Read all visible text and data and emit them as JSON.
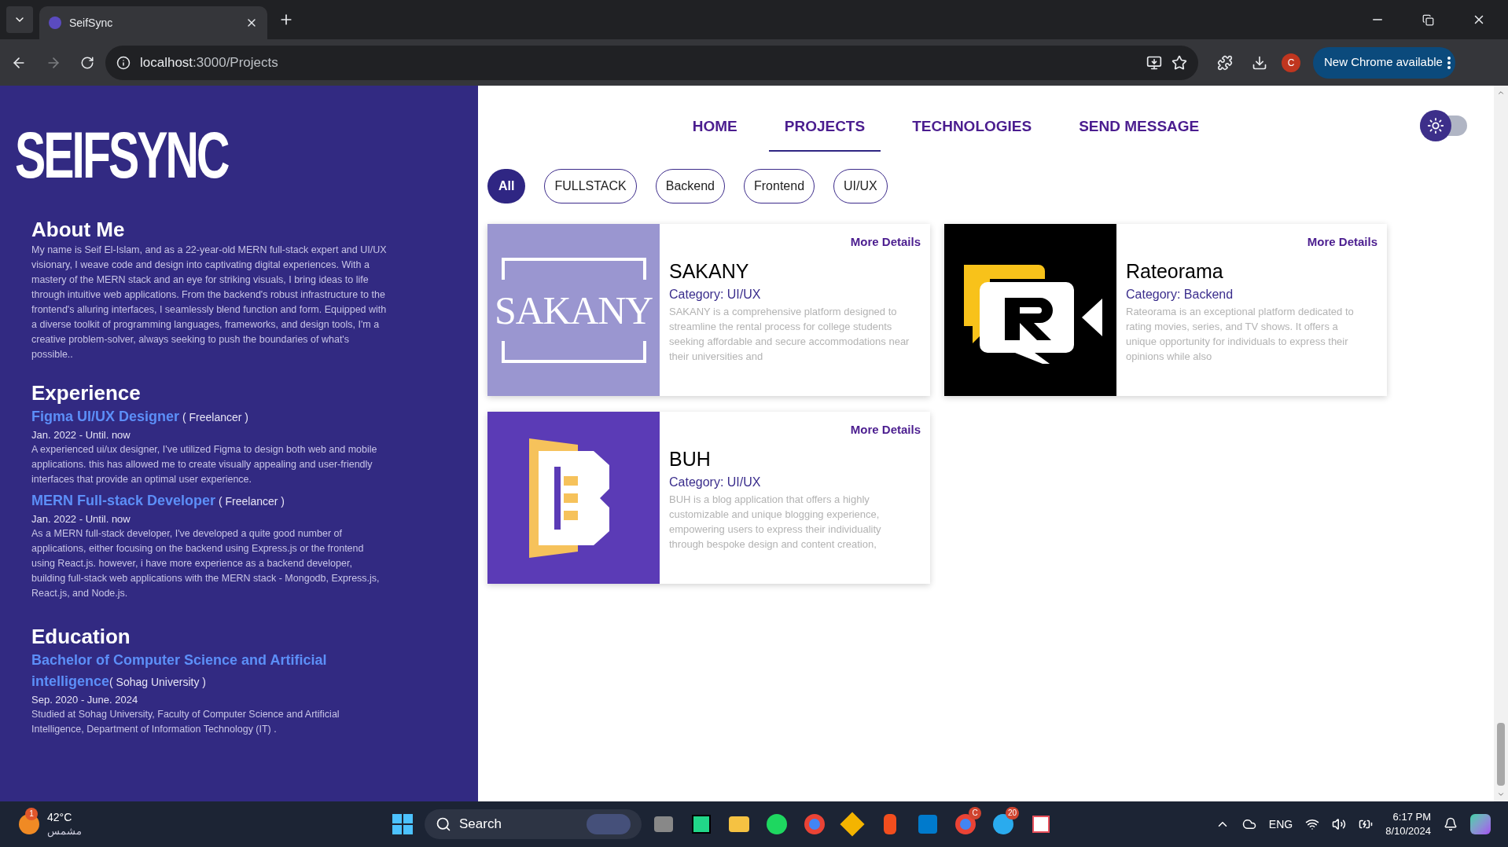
{
  "browser": {
    "tab_title": "SeifSync",
    "url_host": "localhost",
    "url_path": ":3000/Projects",
    "profile": "C",
    "update_button": "New Chrome available"
  },
  "sidebar": {
    "logo": "SEIFSYNC",
    "about": {
      "heading": "About Me",
      "text": "My name is Seif El-Islam, and as a 22-year-old MERN full-stack expert and UI/UX visionary, I weave code and design into captivating digital experiences. With a mastery of the MERN stack and an eye for striking visuals, I bring ideas to life through intuitive web applications. From the backend's robust infrastructure to the frontend's alluring interfaces, I seamlessly blend function and form. Equipped with a diverse toolkit of programming languages, frameworks, and design tools, I'm a creative problem-solver, always seeking to push the boundaries of what's possible.."
    },
    "experience": {
      "heading": "Experience",
      "items": [
        {
          "title": "Figma UI/UX Designer",
          "org": " ( Freelancer )",
          "dates": "Jan. 2022 - Until. now",
          "text": "A experienced ui/ux designer, I've utilized Figma to design both web and mobile applications. this has allowed me to create visually appealing and user-friendly interfaces that provide an optimal user experience."
        },
        {
          "title": "MERN Full-stack Developer",
          "org": " ( Freelancer )",
          "dates": "Jan. 2022 - Until. now",
          "text": "As a MERN full-stack developer, I've developed a quite good number of applications, either focusing on the backend using Express.js or the frontend using React.js. however, i have more experience as a backend developer, building full-stack web applications with the MERN stack - Mongodb, Express.js, React.js, and Node.js."
        }
      ]
    },
    "education": {
      "heading": "Education",
      "items": [
        {
          "title": "Bachelor of Computer Science and Artificial intelligence",
          "org": "( Sohag University )",
          "dates": "Sep. 2020 - June. 2024",
          "text": "Studied at Sohag University, Faculty of Computer Science and Artificial Intelligence, Department of Information Technology (IT) ."
        }
      ]
    }
  },
  "nav": {
    "items": [
      {
        "label": "HOME",
        "selected": false
      },
      {
        "label": "PROJECTS",
        "selected": true
      },
      {
        "label": "TECHNOLOGIES",
        "selected": false
      },
      {
        "label": "SEND MESSAGE",
        "selected": false
      }
    ],
    "theme_toggle": {
      "on": false
    }
  },
  "filters": [
    {
      "label": "All",
      "selected": true
    },
    {
      "label": "FULLSTACK",
      "selected": false
    },
    {
      "label": "Backend",
      "selected": false
    },
    {
      "label": "Frontend",
      "selected": false
    },
    {
      "label": "UI/UX",
      "selected": false
    }
  ],
  "projects": [
    {
      "kind": "sakany",
      "logo_text": "SAKANY",
      "title": "SAKANY",
      "category": "Category: UI/UX",
      "description": "SAKANY is a comprehensive platform designed to streamline the rental process for college students seeking affordable and secure accommodations near their universities and",
      "link": "More Details"
    },
    {
      "kind": "rateorama",
      "title": "Rateorama",
      "category": "Category: Backend",
      "description": "Rateorama is an exceptional platform dedicated to rating movies, series, and TV shows. It offers a unique opportunity for individuals to express their opinions while also",
      "link": "More Details"
    },
    {
      "kind": "buh",
      "title": "BUH",
      "category": "Category: UI/UX",
      "description": "BUH is a blog application that offers a highly customizable and unique blogging experience, empowering users to express their individuality through bespoke design and content creation,",
      "link": "More Details"
    }
  ],
  "taskbar": {
    "weather_badge": "1",
    "temperature": "42°C",
    "weather": "مشمس",
    "search": "Search",
    "chrome_badge": "C",
    "telegram_badge": "20",
    "language": "ENG",
    "time": "6:17 PM",
    "date": "8/10/2024"
  }
}
